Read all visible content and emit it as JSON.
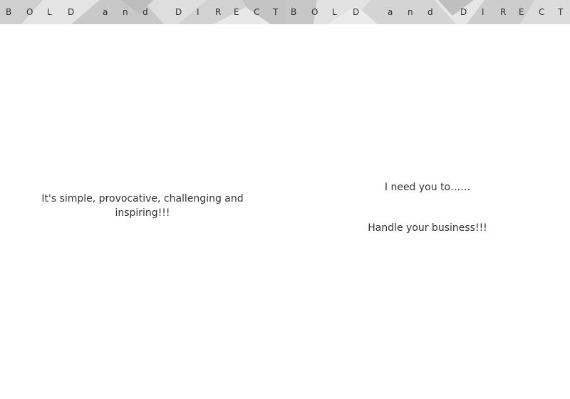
{
  "banner": {
    "letters": [
      "B",
      "O",
      "L",
      "D",
      "a",
      "n",
      "d",
      "D",
      "I",
      "R",
      "E",
      "C",
      "T"
    ]
  },
  "left_page": {
    "text_line_1": "It's simple, provocative, challenging and",
    "text_line_2": "inspiring!!!"
  },
  "right_page": {
    "line_1": "I need you to……",
    "line_2": "Handle your business!!!"
  }
}
